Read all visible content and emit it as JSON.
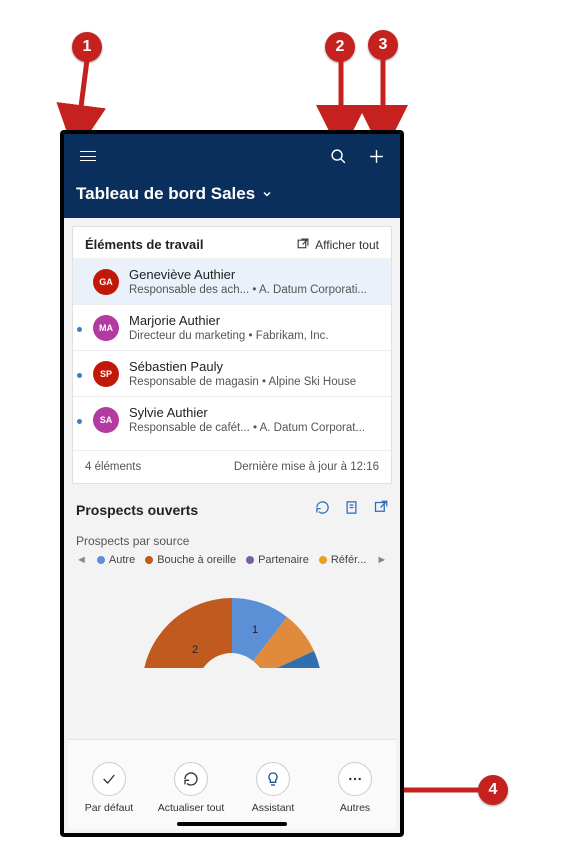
{
  "annotations": {
    "a1": "1",
    "a2": "2",
    "a3": "3",
    "a4": "4"
  },
  "header": {
    "title": "Tableau de bord Sales"
  },
  "work_items": {
    "title": "Éléments de travail",
    "view_all": "Afficher tout",
    "rows": [
      {
        "initials": "GA",
        "color": "#c21807",
        "name": "Geneviève Authier",
        "subtitle": "Responsable des ach...  • A. Datum Corporati...",
        "selected": true,
        "bullet": false
      },
      {
        "initials": "MA",
        "color": "#b33aa0",
        "name": "Marjorie Authier",
        "subtitle": "Directeur du marketing • Fabrikam, Inc.",
        "selected": false,
        "bullet": true
      },
      {
        "initials": "SP",
        "color": "#c21807",
        "name": "Sébastien Pauly",
        "subtitle": "Responsable de magasin • Alpine Ski House",
        "selected": false,
        "bullet": true
      },
      {
        "initials": "SA",
        "color": "#b33aa0",
        "name": "Sylvie Authier",
        "subtitle": "Responsable de cafét...  • A. Datum Corporat...",
        "selected": false,
        "bullet": true
      }
    ],
    "count_label": "4 éléments",
    "updated_label": "Dernière mise à jour à 12:16"
  },
  "prospects": {
    "title": "Prospects ouverts",
    "chart_title": "Prospects par source",
    "legend": [
      {
        "label": "Autre",
        "color": "#5b8fd6"
      },
      {
        "label": "Bouche à oreille",
        "color": "#c05a1f"
      },
      {
        "label": "Partenaire",
        "color": "#7a5fa0"
      },
      {
        "label": "Référ...",
        "color": "#e5a11f"
      }
    ]
  },
  "bottom_bar": {
    "default": "Par défaut",
    "refresh": "Actualiser tout",
    "assistant": "Assistant",
    "more": "Autres"
  },
  "chart_data": {
    "type": "pie",
    "title": "Prospects par source",
    "series": [
      {
        "name": "Bouche à oreille",
        "value": 2,
        "color": "#c05a1f"
      },
      {
        "name": "Autre",
        "value": 1,
        "color": "#5b8fd6"
      },
      {
        "name": "Partenaire",
        "value": 0.6,
        "color": "#e08a3c"
      },
      {
        "name": "Référ...",
        "value": 0.4,
        "color": "#2f6fb0"
      }
    ],
    "note": "semi-donut; only first two slice labels (2 and 1) visible on screen"
  }
}
